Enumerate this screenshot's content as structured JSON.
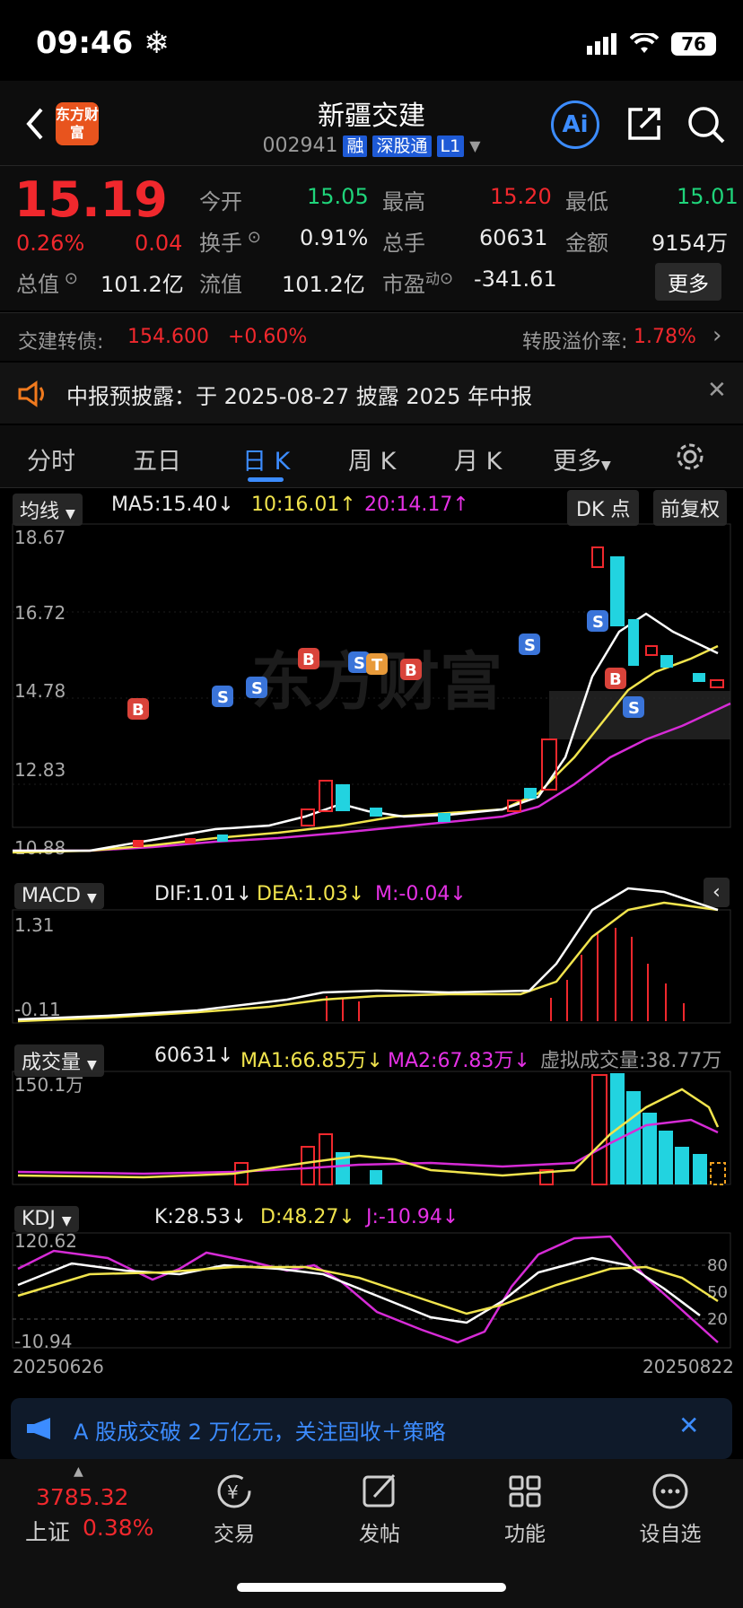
{
  "status": {
    "time": "09:46",
    "battery": "76"
  },
  "header": {
    "logo_text": "东方财富",
    "title": "新疆交建",
    "code": "002941",
    "tags": [
      "融",
      "深股通",
      "L1"
    ],
    "ai_label": "Ai"
  },
  "quote": {
    "price": "15.19",
    "change_pct": "0.26%",
    "change": "0.04",
    "open_label": "今开",
    "open": "15.05",
    "high_label": "最高",
    "high": "15.20",
    "low_label": "最低",
    "low": "15.01",
    "turnover_label": "换手",
    "turnover": "0.91%",
    "volume_label": "总手",
    "volume": "60631",
    "amount_label": "金额",
    "amount": "9154万",
    "mktcap_label": "总值",
    "mktcap": "101.2亿",
    "float_label": "流值",
    "float": "101.2亿",
    "pe_label": "市盈",
    "pe_sup": "动",
    "pe": "-341.61",
    "more": "更多"
  },
  "bond": {
    "label": "交建转债:",
    "price": "154.600",
    "pct": "+0.60%",
    "premium_label": "转股溢价率:",
    "premium": "1.78%"
  },
  "notice": {
    "text": "中报预披露：于 2025-08-27 披露 2025 年中报"
  },
  "tabs": [
    "分时",
    "五日",
    "日 K",
    "周 K",
    "月 K",
    "更多"
  ],
  "kline": {
    "selector": "均线",
    "ma5": "MA5:15.40",
    "ma10": "10:16.01",
    "ma20": "20:14.17",
    "dk": "DK 点",
    "adj": "前复权",
    "y_labels": [
      "18.67",
      "16.72",
      "14.78",
      "12.83",
      "10.88"
    ],
    "watermark": "东方财富"
  },
  "macd": {
    "selector": "MACD",
    "dif": "DIF:1.01",
    "dea": "DEA:1.03",
    "m": "M:-0.04",
    "y_top": "1.31",
    "y_bottom": "-0.11"
  },
  "vol": {
    "selector": "成交量",
    "value": "60631",
    "ma1": "MA1:66.85万",
    "ma2": "MA2:67.83万",
    "virtual": "虚拟成交量:38.77万",
    "y_top": "150.1万"
  },
  "kdj": {
    "selector": "KDJ",
    "k": "K:28.53",
    "d": "D:48.27",
    "j": "J:-10.94",
    "y_top": "120.62",
    "y_bottom": "-10.94",
    "levels": [
      "80",
      "50",
      "20"
    ],
    "date_start": "20250626",
    "date_end": "20250822"
  },
  "ad": {
    "text": "A 股成交破 2 万亿元，关注固收＋策略"
  },
  "nav": {
    "index_value": "3785.32",
    "index_name": "上证",
    "index_pct": "0.38%",
    "items": [
      "交易",
      "发帖",
      "功能",
      "设自选"
    ]
  },
  "colors": {
    "up": "#f0282d",
    "down": "#1fd47a",
    "accent": "#3c8cff",
    "cyan": "#22d3e0"
  }
}
